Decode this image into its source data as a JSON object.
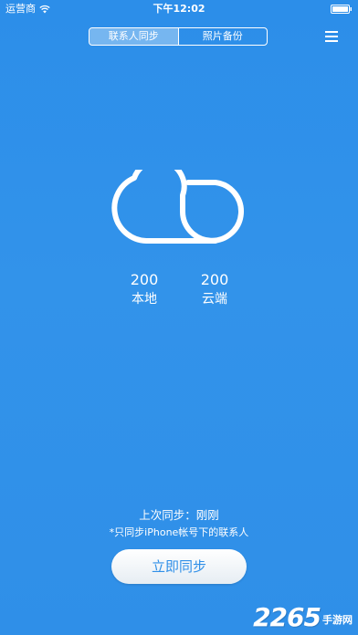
{
  "status_bar": {
    "carrier": "运营商",
    "time": "下午12:02"
  },
  "tabs": [
    {
      "label": "联系人同步",
      "active": true
    },
    {
      "label": "照片备份",
      "active": false
    }
  ],
  "counts": {
    "local": {
      "value": "200",
      "label": "本地"
    },
    "cloud": {
      "value": "200",
      "label": "云端"
    }
  },
  "sync": {
    "last_sync": "上次同步：刚刚",
    "note": "*只同步iPhone帐号下的联系人",
    "button_label": "立即同步"
  },
  "watermark": {
    "number": "2265",
    "text": "手游网"
  },
  "colors": {
    "background": "#2f8fe9",
    "text": "#ffffff",
    "button_text": "#2f8fe8"
  }
}
